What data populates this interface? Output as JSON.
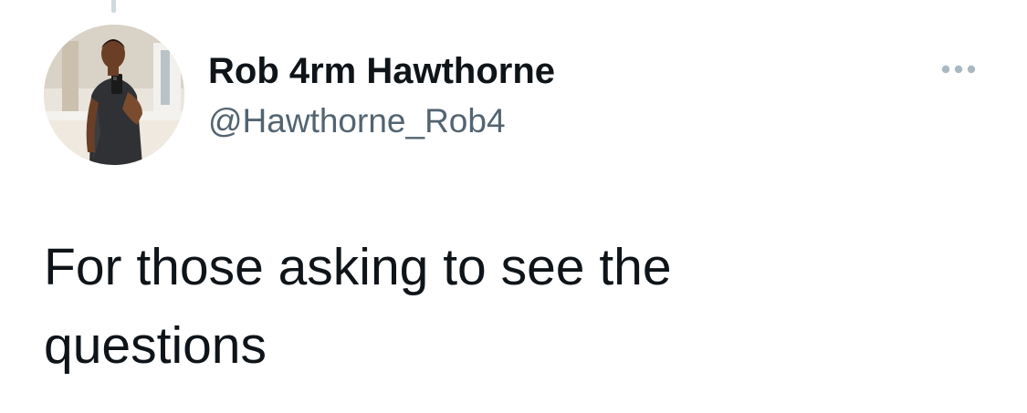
{
  "tweet": {
    "author": {
      "display_name": "Rob 4rm Hawthorne",
      "handle": "@Hawthorne_Rob4",
      "avatar_icon": "profile-photo"
    },
    "more_icon": "more-options-icon",
    "text": "For those asking to see the\nquestions"
  },
  "colors": {
    "text_primary": "#0f1419",
    "text_secondary": "#536471",
    "icon_gray": "#aab8c2",
    "thread_line": "#cfd9de"
  }
}
